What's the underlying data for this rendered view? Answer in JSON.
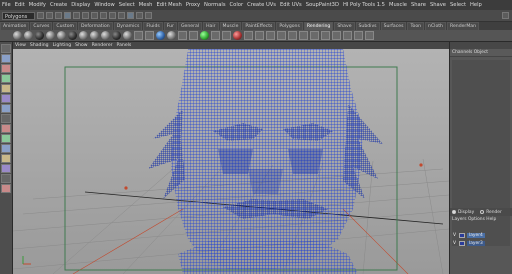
{
  "menubar": {
    "items": [
      "File",
      "Edit",
      "Modify",
      "Create",
      "Display",
      "Window",
      "Select",
      "Mesh",
      "Edit Mesh",
      "Proxy",
      "Normals",
      "Color",
      "Create UVs",
      "Edit UVs",
      "SoupPaint3D",
      "HI Poly Tools 1.5",
      "Muscle",
      "Share",
      "Shave",
      "Select",
      "Help"
    ]
  },
  "statusline": {
    "mode": "Polygons"
  },
  "shelf": {
    "tabs": [
      "Animation",
      "Curves",
      "Custom",
      "Deformation",
      "Dynamics",
      "Fluids",
      "Fur",
      "General",
      "Hair",
      "Muscle",
      "PaintEffects",
      "Polygons",
      "Rendering",
      "Shave",
      "Subdivs",
      "Surfaces",
      "Toon",
      "nCloth",
      "RenderMan"
    ],
    "active_tab": "Rendering"
  },
  "panel_menu": {
    "items": [
      "View",
      "Shading",
      "Lighting",
      "Show",
      "Renderer",
      "Panels"
    ]
  },
  "right_panel": {
    "tabs_label": "Channels Object",
    "layer_modes": [
      "Display",
      "Render"
    ],
    "layer_menu": [
      "Layers",
      "Options",
      "Help"
    ],
    "layers": [
      {
        "visible": "V",
        "name": "layer4"
      },
      {
        "visible": "V",
        "name": "layer3"
      }
    ]
  },
  "colors": {
    "mesh": "#1a3dd6",
    "grid": "#8a8a8a",
    "viewport_top": "#b3b3b3",
    "viewport_bottom": "#9a9a9a",
    "frame_gate": "#3f7a4f",
    "axis_red": "#c24a2e"
  },
  "icons": {
    "toolbox": [
      "select-tool-icon",
      "lasso-tool-icon",
      "paint-select-icon",
      "move-tool-icon",
      "rotate-tool-icon",
      "scale-tool-icon",
      "soft-mod-icon",
      "show-manip-icon",
      "last-tool-icon",
      "layout-single-icon",
      "layout-four-icon",
      "layout-side-icon",
      "layout-stack-icon",
      "outliner-icon",
      "graph-editor-icon"
    ]
  }
}
